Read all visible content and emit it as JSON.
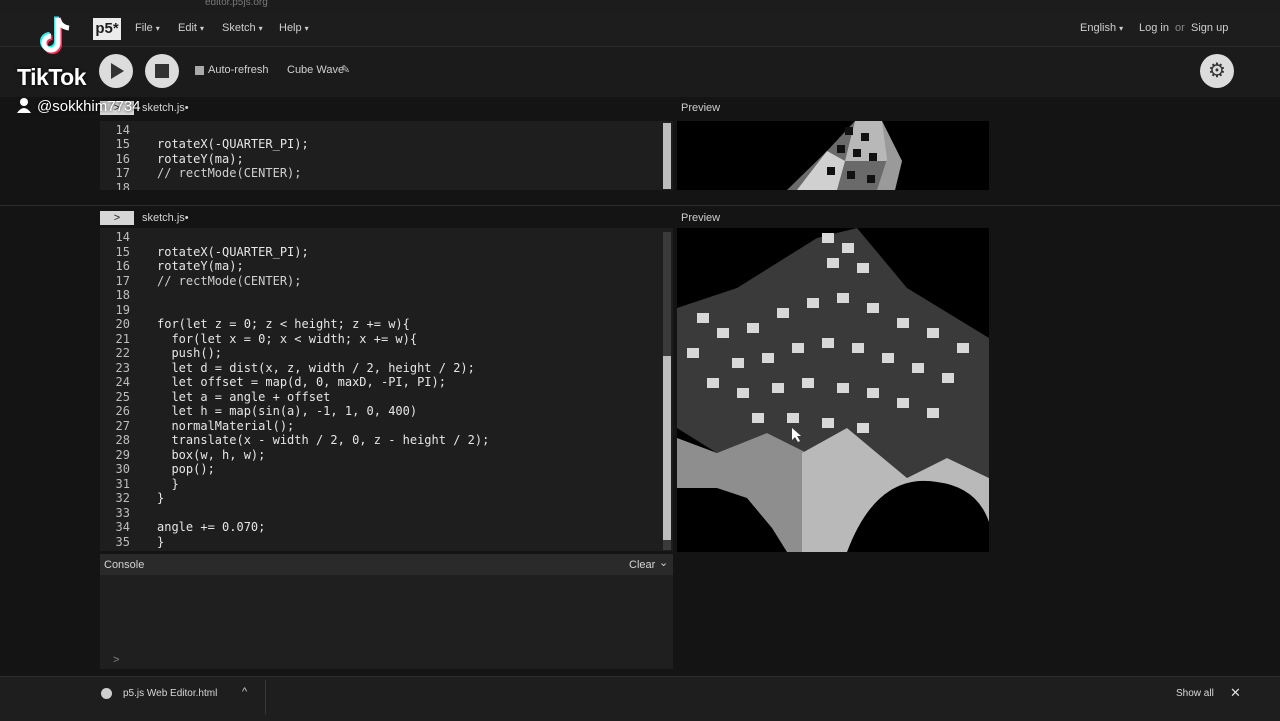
{
  "browser": {
    "url": "editor.p5js.org"
  },
  "menubar": {
    "logo": "p5*",
    "items": [
      {
        "label": "File"
      },
      {
        "label": "Edit"
      },
      {
        "label": "Sketch"
      },
      {
        "label": "Help"
      }
    ],
    "language": "English",
    "login": "Log in",
    "or": "or",
    "signup": "Sign up"
  },
  "toolbar": {
    "auto_refresh_label": "Auto-refresh",
    "sketch_name": "Cube Wave",
    "pencil_icon": "pencil-icon",
    "settings_icon": "gear-icon"
  },
  "overlay": {
    "brand": "TikTok",
    "handle": "@sokkhim7734"
  },
  "mini_panel": {
    "expand": ">",
    "file_tab": "sketch.js",
    "unsaved_dot": "•",
    "preview_label": "Preview",
    "lines": [
      {
        "n": "14",
        "code": ""
      },
      {
        "n": "15",
        "code": "rotateX(-QUARTER_PI);"
      },
      {
        "n": "16",
        "code": "rotateY(ma);"
      },
      {
        "n": "17",
        "code": "// rectMode(CENTER);"
      },
      {
        "n": "18",
        "code": ""
      }
    ]
  },
  "editor": {
    "expand": ">",
    "file_tab": "sketch.js",
    "unsaved_dot": "•",
    "lines": [
      {
        "n": "14",
        "code": ""
      },
      {
        "n": "15",
        "code": "rotateX(-QUARTER_PI);"
      },
      {
        "n": "16",
        "code": "rotateY(ma);"
      },
      {
        "n": "17",
        "code": "// rectMode(CENTER);"
      },
      {
        "n": "18",
        "code": ""
      },
      {
        "n": "19",
        "code": ""
      },
      {
        "n": "20",
        "code": "for(let z = 0; z < height; z += w){"
      },
      {
        "n": "21",
        "code": "  for(let x = 0; x < width; x += w){"
      },
      {
        "n": "22",
        "code": "  push();"
      },
      {
        "n": "23",
        "code": "  let d = dist(x, z, width / 2, height / 2);"
      },
      {
        "n": "24",
        "code": "  let offset = map(d, 0, maxD, -PI, PI);"
      },
      {
        "n": "25",
        "code": "  let a = angle + offset"
      },
      {
        "n": "26",
        "code": "  let h = map(sin(a), -1, 1, 0, 400)"
      },
      {
        "n": "27",
        "code": "  normalMaterial();"
      },
      {
        "n": "28",
        "code": "  translate(x - width / 2, 0, z - height / 2);"
      },
      {
        "n": "29",
        "code": "  box(w, h, w);"
      },
      {
        "n": "30",
        "code": "  pop();"
      },
      {
        "n": "31",
        "code": "  }"
      },
      {
        "n": "32",
        "code": "}"
      },
      {
        "n": "33",
        "code": ""
      },
      {
        "n": "34",
        "code": "angle += 0.070;"
      },
      {
        "n": "35",
        "code": "}"
      }
    ]
  },
  "preview": {
    "label": "Preview"
  },
  "console": {
    "label": "Console",
    "clear": "Clear",
    "collapse": "⌄",
    "prompt": ">"
  },
  "download_bar": {
    "file_name": "p5.js Web Editor.html",
    "chevron": "^",
    "show_all": "Show all",
    "close": "✕"
  }
}
